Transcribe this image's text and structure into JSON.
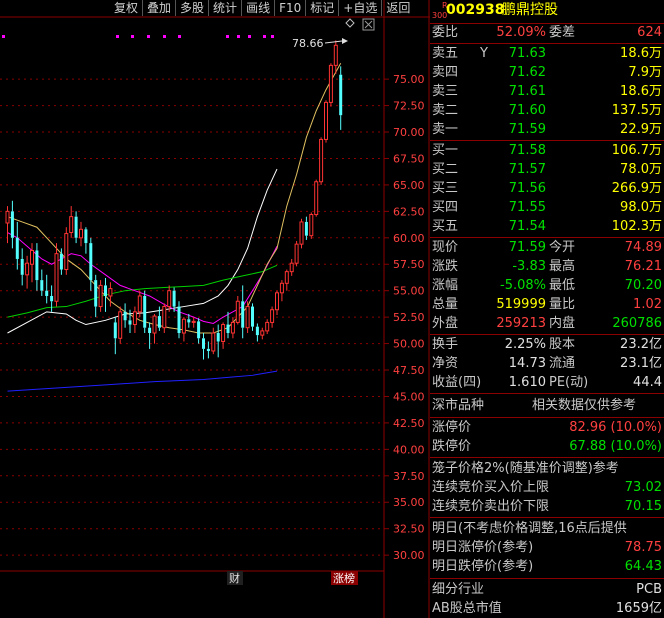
{
  "toolbar": [
    "复权",
    "叠加",
    "多股",
    "统计",
    "画线",
    "F10",
    "+自选",
    "返回"
  ],
  "stock": {
    "badge_top": "R",
    "badge_bottom": "300",
    "code": "002938",
    "name": "鹏鼎控股"
  },
  "webi": {
    "l1": "委比",
    "v1": "52.09%",
    "l2": "委差",
    "v2": "624"
  },
  "asks": [
    {
      "label": "卖五",
      "mark": "Y",
      "price": "71.63",
      "vol": "18.6万"
    },
    {
      "label": "卖四",
      "price": "71.62",
      "vol": "7.9万"
    },
    {
      "label": "卖三",
      "price": "71.61",
      "vol": "18.6万"
    },
    {
      "label": "卖二",
      "price": "71.60",
      "vol": "137.5万"
    },
    {
      "label": "卖一",
      "price": "71.59",
      "vol": "22.9万"
    }
  ],
  "bids": [
    {
      "label": "买一",
      "price": "71.58",
      "vol": "106.7万"
    },
    {
      "label": "买二",
      "price": "71.57",
      "vol": "78.0万"
    },
    {
      "label": "买三",
      "price": "71.56",
      "vol": "266.9万"
    },
    {
      "label": "买四",
      "price": "71.55",
      "vol": "98.0万"
    },
    {
      "label": "买五",
      "price": "71.54",
      "vol": "102.3万"
    }
  ],
  "quote": [
    {
      "l1": "现价",
      "v1": "71.59",
      "l2": "今开",
      "v2": "74.89"
    },
    {
      "l1": "涨跌",
      "v1": "-3.83",
      "l2": "最高",
      "v2": "76.21"
    },
    {
      "l1": "涨幅",
      "v1": "-5.08%",
      "l2": "最低",
      "v2": "70.20"
    },
    {
      "l1": "总量",
      "v1": "519999",
      "l2": "量比",
      "v2": "1.02"
    },
    {
      "l1": "外盘",
      "v1": "259213",
      "l2": "内盘",
      "v2": "260786"
    }
  ],
  "fin": [
    {
      "l1": "换手",
      "v1": "2.25%",
      "l2": "股本",
      "v2": "23.2亿"
    },
    {
      "l1": "净资",
      "v1": "14.73",
      "l2": "流通",
      "v2": "23.1亿"
    },
    {
      "l1": "收益(四)",
      "v1": "1.610",
      "l2": "PE(动)",
      "v2": "44.4"
    }
  ],
  "market": {
    "left": "深市品种",
    "right": "相关数据仅供参考"
  },
  "limits": [
    {
      "label": "涨停价",
      "value": "82.96 (10.0%)"
    },
    {
      "label": "跌停价",
      "value": "67.88 (10.0%)"
    }
  ],
  "cage": {
    "title": "笼子价格2%(随基准价调整)参考",
    "buy_label": "连续竞价买入价上限",
    "buy_value": "73.02",
    "sell_label": "连续竞价卖出价下限",
    "sell_value": "70.15"
  },
  "tomorrow": {
    "title": "明日(不考虑价格调整,16点后提供",
    "up_label": "明日涨停价(参考)",
    "up_value": "78.75",
    "down_label": "明日跌停价(参考)",
    "down_value": "64.43"
  },
  "industry": {
    "label": "细分行业",
    "value": "PCB"
  },
  "mcap": {
    "label": "AB股总市值",
    "value": "1659亿"
  },
  "chart_markers": {
    "finance": "财",
    "limit_list": "涨榜"
  },
  "chart_data": {
    "type": "candlestick",
    "y_ticks": [
      30,
      32.5,
      35,
      37.5,
      40,
      42.5,
      45,
      47.5,
      50,
      52.5,
      55,
      57.5,
      60,
      62.5,
      65,
      67.5,
      70,
      72.5,
      75
    ],
    "ylim": [
      28.5,
      78.7
    ],
    "high_label": "78.66",
    "candles": [
      [
        61.4,
        63,
        59.5,
        62.5
      ],
      [
        62.5,
        63.5,
        59,
        60
      ],
      [
        60,
        61.5,
        57,
        58
      ],
      [
        58,
        59,
        55.5,
        56.5
      ],
      [
        56.5,
        58.3,
        55.2,
        57.6
      ],
      [
        57.5,
        59.5,
        55.8,
        58.8
      ],
      [
        58.8,
        59.5,
        55,
        56
      ],
      [
        56,
        57,
        54.5,
        55
      ],
      [
        55,
        56.5,
        53.8,
        54.5
      ],
      [
        54.5,
        55.5,
        53,
        54
      ],
      [
        54,
        59.5,
        53.5,
        58.5
      ],
      [
        58.5,
        59,
        56.5,
        57
      ],
      [
        57,
        61,
        56.5,
        60.4
      ],
      [
        60.5,
        63,
        60,
        62
      ],
      [
        62,
        62.5,
        59.5,
        60
      ],
      [
        60,
        61.5,
        59.2,
        60.8
      ],
      [
        60.8,
        61,
        58.5,
        59.5
      ],
      [
        59.5,
        60,
        55,
        56
      ],
      [
        56,
        56.5,
        52.5,
        53.5
      ],
      [
        53.5,
        56,
        53,
        55.5
      ],
      [
        55.5,
        56.2,
        53,
        54.5
      ],
      [
        54.5,
        55.8,
        53.5,
        55.2
      ],
      [
        52,
        52.5,
        49,
        50.5
      ],
      [
        50.5,
        53.5,
        50,
        53
      ],
      [
        53,
        53.8,
        51.5,
        52.2
      ],
      [
        52.2,
        53.2,
        51,
        51.8
      ],
      [
        51.8,
        53.5,
        51,
        53
      ],
      [
        53,
        55,
        52.5,
        54.5
      ],
      [
        54.5,
        55,
        51,
        51.5
      ],
      [
        51.5,
        52,
        49.5,
        51
      ],
      [
        51,
        52.8,
        50,
        52.6
      ],
      [
        52.6,
        53.5,
        51.2,
        51.5
      ],
      [
        51.5,
        53.8,
        51,
        53.5
      ],
      [
        53.5,
        55.5,
        53,
        55
      ],
      [
        55,
        55.3,
        53,
        53.5
      ],
      [
        53.5,
        54,
        50.5,
        51
      ],
      [
        51,
        52.5,
        50.2,
        52.3
      ],
      [
        52.3,
        52.8,
        51.5,
        52
      ],
      [
        52,
        52.5,
        51.5,
        52.1
      ],
      [
        52.1,
        52.4,
        50,
        50.5
      ],
      [
        50.5,
        51,
        48.5,
        49.5
      ],
      [
        49.5,
        50.2,
        48.6,
        49.3
      ],
      [
        49.3,
        51.5,
        49,
        51
      ],
      [
        51,
        51.8,
        48.7,
        50.2
      ],
      [
        50.2,
        52,
        49.5,
        51.8
      ],
      [
        51.8,
        53,
        50.5,
        51
      ],
      [
        51,
        52.5,
        50.5,
        52
      ],
      [
        52,
        54.5,
        51.8,
        54
      ],
      [
        54,
        55.5,
        50.5,
        51.5
      ],
      [
        51.5,
        54,
        51,
        53.5
      ],
      [
        53.5,
        53.8,
        51.2,
        51.6
      ],
      [
        51.6,
        51.9,
        50.2,
        50.8
      ],
      [
        50.8,
        51.5,
        50.4,
        51.2
      ],
      [
        51.2,
        52.3,
        50.9,
        52
      ],
      [
        52,
        53.5,
        51.5,
        53.2
      ],
      [
        53.2,
        55,
        52.7,
        54.8
      ],
      [
        54.8,
        56,
        54,
        55.7
      ],
      [
        55.7,
        57,
        55,
        56.8
      ],
      [
        56.8,
        58,
        56.4,
        57.6
      ],
      [
        57.6,
        59.7,
        57.3,
        59.4
      ],
      [
        59.4,
        61.8,
        59,
        61.5
      ],
      [
        61.5,
        62,
        59.8,
        60.2
      ],
      [
        60.2,
        62.4,
        59.9,
        62.2
      ],
      [
        62.2,
        65.5,
        62,
        65.3
      ],
      [
        65.3,
        69.5,
        65,
        69.3
      ],
      [
        69.3,
        73,
        69,
        72.8
      ],
      [
        72.8,
        76.5,
        72.4,
        76.3
      ],
      [
        76.3,
        78.66,
        75.5,
        78.2
      ],
      [
        75.42,
        76.21,
        70.2,
        71.59
      ]
    ],
    "ma_lines": [
      {
        "color": "#ffffff",
        "points": [
          [
            0,
            51
          ],
          [
            4,
            52
          ],
          [
            8,
            53
          ],
          [
            12,
            52.8
          ],
          [
            14,
            52.2
          ],
          [
            16,
            51.8
          ],
          [
            20,
            52.2
          ],
          [
            24,
            52.8
          ],
          [
            28,
            52.9
          ],
          [
            32,
            53.2
          ],
          [
            36,
            53.5
          ],
          [
            40,
            53.8
          ],
          [
            43,
            54.5
          ],
          [
            45,
            55.5
          ],
          [
            47,
            57
          ],
          [
            49,
            59
          ],
          [
            51,
            62
          ],
          [
            53,
            64.5
          ],
          [
            55,
            66.5
          ]
        ]
      },
      {
        "color": "#00d000",
        "points": [
          [
            0,
            52.5
          ],
          [
            4,
            52.9
          ],
          [
            8,
            53.4
          ],
          [
            12,
            53.5
          ],
          [
            16,
            54
          ],
          [
            20,
            54.6
          ],
          [
            24,
            55
          ],
          [
            28,
            55.2
          ],
          [
            32,
            55.3
          ],
          [
            36,
            55.4
          ],
          [
            40,
            55.5
          ],
          [
            44,
            56
          ],
          [
            48,
            56.4
          ],
          [
            52,
            56.8
          ],
          [
            55,
            57.4
          ]
        ]
      },
      {
        "color": "#ff00ff",
        "points": [
          [
            0,
            60.5
          ],
          [
            2,
            60
          ],
          [
            4,
            59.2
          ],
          [
            7,
            58
          ],
          [
            9,
            57.5
          ],
          [
            11,
            58
          ],
          [
            13,
            58.5
          ],
          [
            15,
            58.3
          ],
          [
            17,
            57.5
          ],
          [
            20,
            56.5
          ],
          [
            23,
            55.5
          ],
          [
            26,
            55
          ],
          [
            29,
            54.5
          ],
          [
            32,
            53.7
          ],
          [
            35,
            53
          ],
          [
            38,
            52.5
          ],
          [
            40,
            52.1
          ],
          [
            42,
            51.9
          ],
          [
            44,
            52.5
          ],
          [
            46,
            53
          ],
          [
            48,
            53.5
          ],
          [
            50,
            55
          ],
          [
            52,
            56.5
          ],
          [
            54,
            58.3
          ],
          [
            55,
            59.2
          ]
        ]
      },
      {
        "color": "#e0c060",
        "points": [
          [
            0,
            62
          ],
          [
            3,
            61.5
          ],
          [
            6,
            61
          ],
          [
            9,
            59.5
          ],
          [
            12,
            58
          ],
          [
            15,
            57
          ],
          [
            18,
            55.5
          ],
          [
            21,
            54
          ],
          [
            24,
            53
          ],
          [
            27,
            52.2
          ],
          [
            30,
            51.8
          ],
          [
            33,
            51.5
          ],
          [
            36,
            51.3
          ],
          [
            39,
            51
          ],
          [
            42,
            51
          ],
          [
            45,
            51.5
          ],
          [
            47,
            52.5
          ],
          [
            49,
            53.5
          ],
          [
            51,
            55.5
          ],
          [
            53,
            57.5
          ],
          [
            55,
            59
          ],
          [
            57,
            63
          ],
          [
            59,
            66
          ],
          [
            61,
            69.5
          ],
          [
            63,
            72
          ],
          [
            65,
            74
          ],
          [
            68,
            76.5
          ]
        ]
      },
      {
        "color": "#2020ff",
        "points": [
          [
            0,
            45.5
          ],
          [
            10,
            45.8
          ],
          [
            20,
            46.1
          ],
          [
            30,
            46.4
          ],
          [
            40,
            46.6
          ],
          [
            45,
            46.8
          ],
          [
            50,
            47
          ],
          [
            55,
            47.4
          ]
        ]
      }
    ]
  }
}
